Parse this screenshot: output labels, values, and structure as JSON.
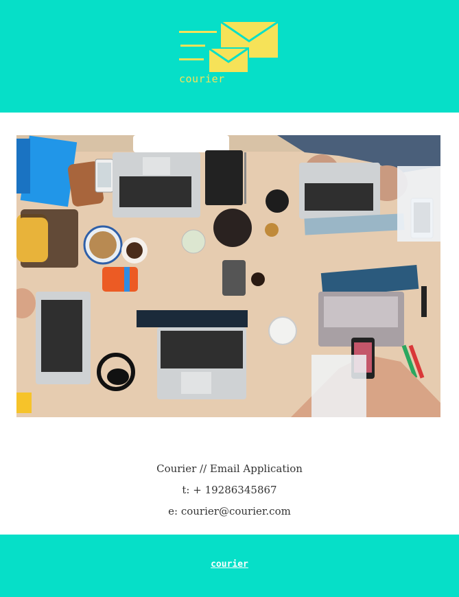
{
  "brand": {
    "name": "courier",
    "logo_icon": "mail-envelopes-icon",
    "accent": "#06dfc8",
    "logo_color": "#f6e258"
  },
  "hero": {
    "image": "photo of a wooden desk with laptops, phones, notebooks, coffee cups and headphones seen from above"
  },
  "contact": {
    "title": "Courier // Email Application",
    "phone": "t: + 19286345867",
    "email": "e: courier@courier.com"
  },
  "footer": {
    "link_label": "courier"
  }
}
